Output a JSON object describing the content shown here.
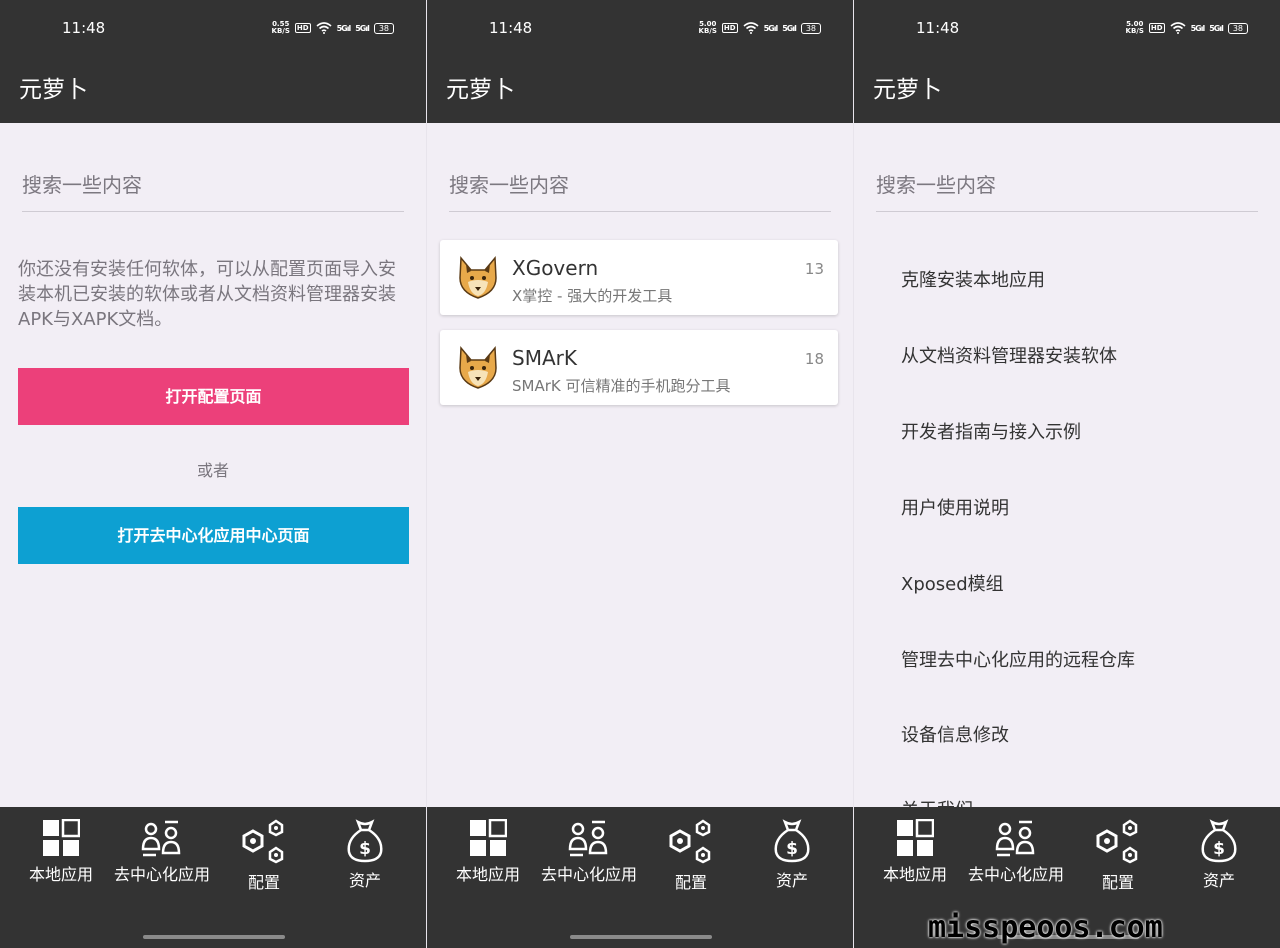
{
  "status": {
    "time": "11:48",
    "net_speeds": [
      "0.55",
      "5.00",
      "5.00"
    ],
    "net_unit": "KB/S",
    "hd": "HD",
    "sig1": "5G",
    "sig2": "5G",
    "battery": "38"
  },
  "app": {
    "title": "元萝卜"
  },
  "search": {
    "placeholder": "搜索一些内容"
  },
  "local": {
    "empty_message": "你还没有安装任何软体，可以从配置页面导入安装本机已安装的软体或者从文档资料管理器安装APK与XAPK文档。",
    "open_config_button": "打开配置页面",
    "or_label": "或者",
    "open_decentral_button": "打开去中心化应用中心页面"
  },
  "decentral": {
    "apps": [
      {
        "name": "XGovern",
        "description": "X掌控 - 强大的开发工具",
        "count": "13"
      },
      {
        "name": "SMArK",
        "description": "SMArK 可信精准的手机跑分工具",
        "count": "18"
      }
    ]
  },
  "config": {
    "items": [
      "克隆安装本地应用",
      "从文档资料管理器安装软体",
      "开发者指南与接入示例",
      "用户使用说明",
      "Xposed模组",
      "管理去中心化应用的远程仓库",
      "设备信息修改",
      "关于我们"
    ]
  },
  "nav": [
    {
      "label": "本地应用",
      "icon": "grid-icon"
    },
    {
      "label": "去中心化应用",
      "icon": "people-icon"
    },
    {
      "label": "配置",
      "icon": "hexagon-nodes-icon"
    },
    {
      "label": "资产",
      "icon": "money-bag-icon"
    }
  ],
  "watermark": "misspeoos.com",
  "colors": {
    "bar": "#333333",
    "background": "#f2eef5",
    "pink": "#ec407a",
    "blue": "#0da0d2"
  }
}
